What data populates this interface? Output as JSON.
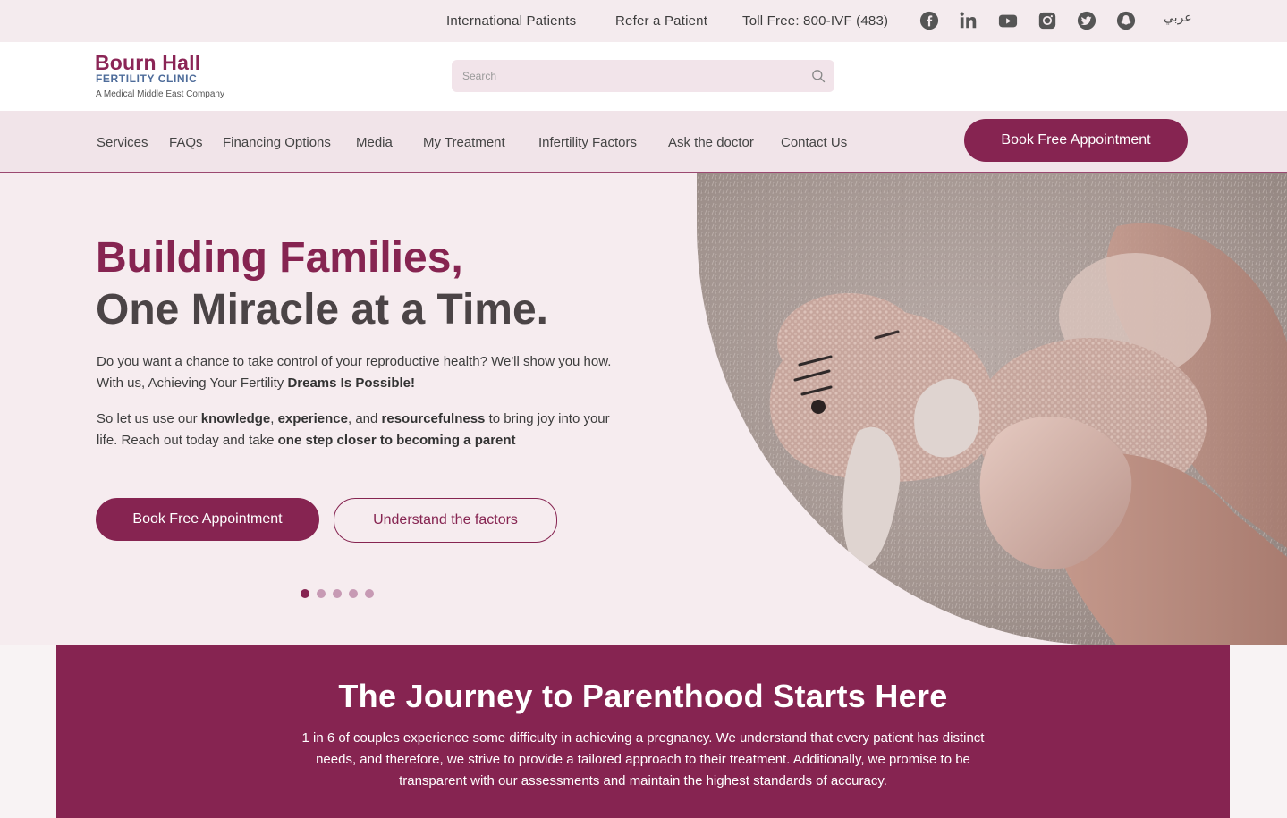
{
  "topbar": {
    "links": [
      "International Patients",
      "Refer a Patient",
      "Toll Free: 800-IVF (483)"
    ],
    "social_icons": [
      "facebook-icon",
      "linkedin-icon",
      "youtube-icon",
      "instagram-icon",
      "twitter-icon",
      "snapchat-icon"
    ],
    "language": "عربي"
  },
  "header": {
    "logo_name": "Bourn Hall",
    "logo_sub": "FERTILITY CLINIC",
    "logo_tagline": "A Medical Middle East Company",
    "search_placeholder": "Search"
  },
  "nav": {
    "items": [
      "Services",
      "FAQs",
      "Financing Options",
      "Media",
      "My Treatment",
      "Infertility Factors",
      "Ask the doctor",
      "Contact Us"
    ],
    "cta": "Book Free Appointment"
  },
  "hero": {
    "title_line1": "Building Families,",
    "title_line2": "One Miracle at a Time.",
    "p1_a": "Do you want a chance to take control of your reproductive health? We'll show you how. With us, Achieving Your Fertility ",
    "p1_b": "Dreams Is Possible!",
    "p2_a": "So let us use our ",
    "p2_b": "knowledge",
    "p2_c": ", ",
    "p2_d": "experience",
    "p2_e": ", and ",
    "p2_f": "resourcefulness",
    "p2_g": " to bring joy into your life. Reach out today and take ",
    "p2_h": "one step closer to becoming a parent",
    "primary_button": "Book Free Appointment",
    "secondary_button": "Understand the factors",
    "slides_total": 5,
    "slide_active": 1
  },
  "journey": {
    "title": "The Journey to Parenthood Starts Here",
    "text": "1 in 6 of couples experience some difficulty in achieving a pregnancy. We understand that every patient has distinct needs, and therefore, we strive to provide a tailored approach to their treatment. Additionally, we promise to be transparent with our assessments and maintain the highest standards of accuracy."
  },
  "colors": {
    "brand": "#862451",
    "logo_sub": "#4e6c9a",
    "nav_bg": "#f1e4e9",
    "hero_bg": "#f6ecef"
  }
}
